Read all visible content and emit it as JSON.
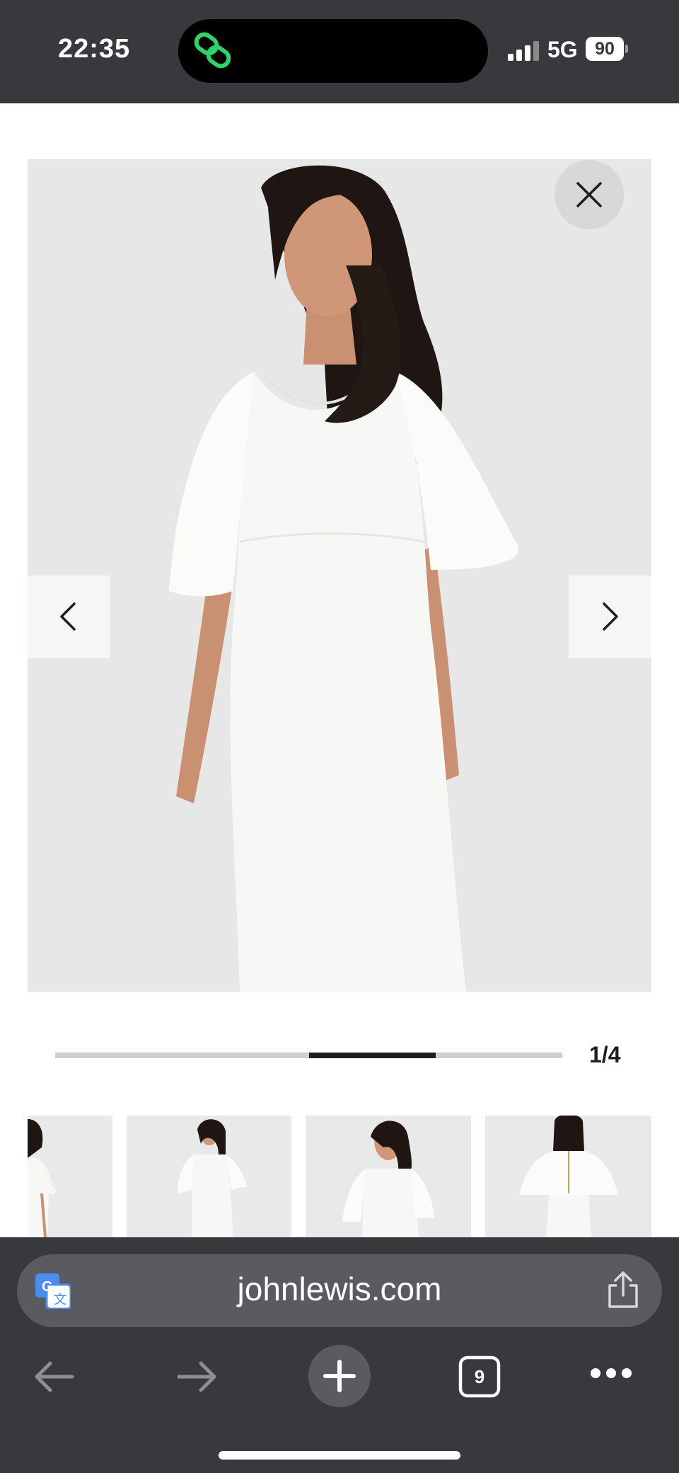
{
  "status_bar": {
    "time": "22:35",
    "network": "5G",
    "battery": "90",
    "island_app_icon": "link-chain-icon"
  },
  "gallery": {
    "current_index": 1,
    "total": 4,
    "counter_text": "1/4",
    "progress": {
      "start_fraction": 0.5,
      "end_fraction": 0.75
    },
    "thumbnails": [
      {
        "view": "side"
      },
      {
        "view": "front-full"
      },
      {
        "view": "front-closeup"
      },
      {
        "view": "back"
      }
    ],
    "close_icon": "close-icon",
    "prev_icon": "chevron-left-icon",
    "next_icon": "chevron-right-icon"
  },
  "browser": {
    "url": "johnlewis.com",
    "tab_count": "9",
    "colors": {
      "bar": "#38393c",
      "pill": "#5a5b60",
      "translate_accent": "#4a8cf0"
    },
    "icons": [
      "translate-icon",
      "share-icon",
      "back-arrow-icon",
      "forward-arrow-icon",
      "new-tab-plus-icon",
      "tabs-icon",
      "more-dots-icon"
    ]
  }
}
